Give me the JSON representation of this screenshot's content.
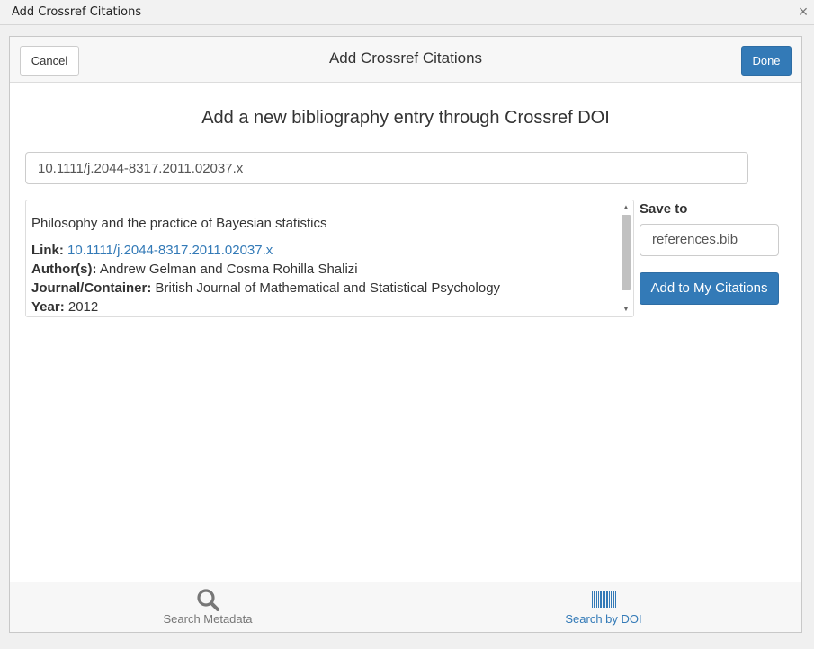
{
  "window": {
    "title": "Add Crossref Citations",
    "close_glyph": "×"
  },
  "dialog": {
    "title": "Add Crossref Citations",
    "cancel_label": "Cancel",
    "done_label": "Done",
    "heading": "Add a new bibliography entry through Crossref DOI"
  },
  "doi_input": {
    "value": "10.1111/j.2044-8317.2011.02037.x"
  },
  "result": {
    "title": "Philosophy and the practice of Bayesian statistics",
    "link_label": "Link:",
    "link_value": "10.1111/j.2044-8317.2011.02037.x",
    "authors_label": "Author(s):",
    "authors_value": "Andrew Gelman and Cosma Rohilla Shalizi",
    "journal_label": "Journal/Container:",
    "journal_value": "British Journal of Mathematical and Statistical Psychology",
    "year_label": "Year:",
    "year_value": "2012"
  },
  "save": {
    "label": "Save to",
    "selected": "references.bib",
    "add_label": "Add to My Citations"
  },
  "footer": {
    "tabs": [
      {
        "label": "Search Metadata",
        "icon": "search-icon",
        "active": false
      },
      {
        "label": "Search by DOI",
        "icon": "barcode-icon",
        "active": true
      }
    ]
  },
  "colors": {
    "accent": "#337ab7",
    "inactive_tab": "#777777"
  }
}
